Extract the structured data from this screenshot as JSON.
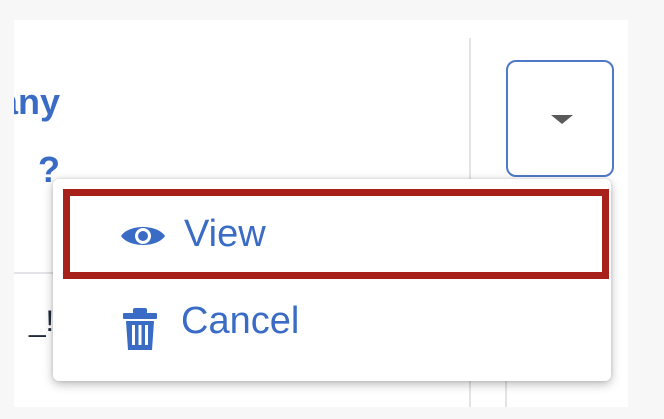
{
  "left_column": {
    "link_line1": "Company",
    "link_line2": "?",
    "cell_fragment": "!_"
  },
  "actions_dropdown": {
    "toggle_icon": "caret-down-icon"
  },
  "menu": {
    "items": [
      {
        "label": "View",
        "icon": "eye-icon",
        "highlighted": true
      },
      {
        "label": "Cancel",
        "icon": "trash-icon",
        "highlighted": false
      }
    ]
  },
  "colors": {
    "link": "#3a6cc6",
    "toggle_border": "#4f79c6",
    "highlight_border": "#a8201a"
  }
}
